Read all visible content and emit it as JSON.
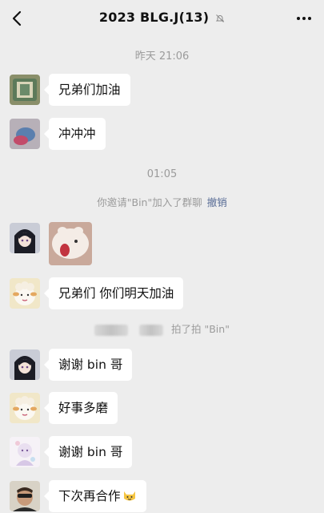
{
  "header": {
    "title": "2023 BLG.J(13)"
  },
  "timestamps": [
    "昨天 21:06",
    "01:05"
  ],
  "system": {
    "invite_text": "你邀请\"Bin\"加入了群聊",
    "revoke_label": "撤销",
    "pat_text": "拍了拍 \"Bin\""
  },
  "messages": [
    {
      "text": "兄弟们加油"
    },
    {
      "text": "冲冲冲"
    },
    {
      "text": ""
    },
    {
      "text": "兄弟们 你们明天加油"
    },
    {
      "text": "谢谢 bin 哥"
    },
    {
      "text": "好事多磨"
    },
    {
      "text": "谢谢 bin 哥"
    },
    {
      "text": "下次再合作"
    }
  ],
  "colors": {
    "background": "#ededed",
    "bubble": "#ffffff",
    "link": "#576b95",
    "meta": "#9b9b9b"
  },
  "icons": [
    "back-icon",
    "mute-icon",
    "more-icon",
    "cat-emoji-icon"
  ]
}
